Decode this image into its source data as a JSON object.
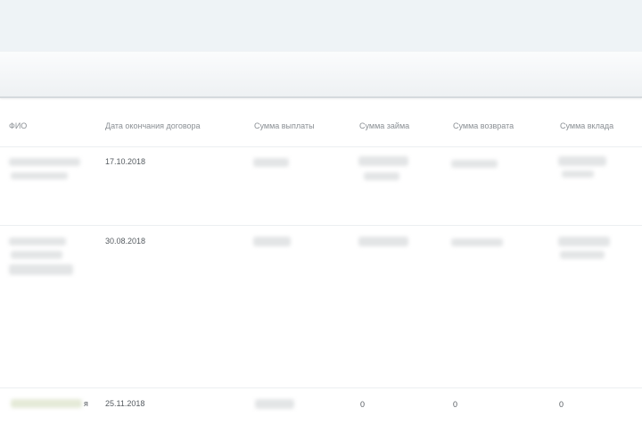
{
  "table": {
    "columns": [
      "ФИО",
      "Дата окончания договора",
      "Сумма выплаты",
      "Сумма займа",
      "Сумма возврата",
      "Сумма вклада"
    ],
    "rows": [
      {
        "fio": "",
        "end_date": "17.10.2018",
        "payout": "",
        "loan": "",
        "return": "",
        "deposit": ""
      },
      {
        "fio": "",
        "end_date": "30.08.2018",
        "payout": "",
        "loan": "",
        "return": "",
        "deposit": ""
      },
      {
        "fio_suffix": "я",
        "end_date": "25.11.2018",
        "payout": "",
        "loan": "0",
        "return": "0",
        "deposit": "0"
      }
    ]
  }
}
